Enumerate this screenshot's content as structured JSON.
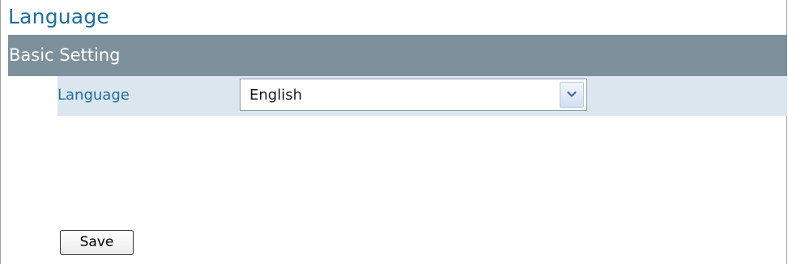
{
  "page": {
    "title": "Language"
  },
  "section": {
    "title": "Basic Setting"
  },
  "language_setting": {
    "label": "Language",
    "selected_value": "English",
    "options": [
      "English"
    ],
    "arrow_icon": "chevron-down-icon"
  },
  "actions": {
    "save_label": "Save"
  },
  "colors": {
    "title_text": "#1f6f9d",
    "section_bar": "#7d919c",
    "row_background": "#dce6ef"
  }
}
